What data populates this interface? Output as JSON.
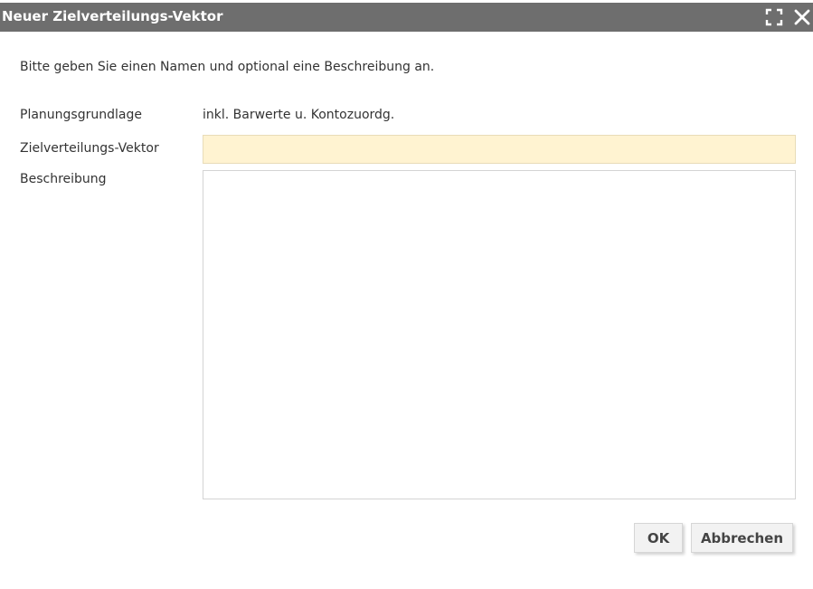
{
  "dialog": {
    "title": "Neuer Zielverteilungs-Vektor",
    "maximize_icon": "maximize-icon",
    "close_icon": "close-icon"
  },
  "intro_text": "Bitte geben Sie einen Namen und optional eine Beschreibung an.",
  "form": {
    "planungsgrundlage_label": "Planungsgrundlage",
    "planungsgrundlage_value": "inkl. Barwerte u. Kontozuordg.",
    "vektor_label": "Zielverteilungs-Vektor",
    "vektor_value": "",
    "beschreibung_label": "Beschreibung",
    "beschreibung_value": ""
  },
  "buttons": {
    "ok_label": "OK",
    "cancel_label": "Abbrechen"
  },
  "colors": {
    "titlebar_bg": "#6e6e6e",
    "required_field_bg": "#fff3d1"
  }
}
